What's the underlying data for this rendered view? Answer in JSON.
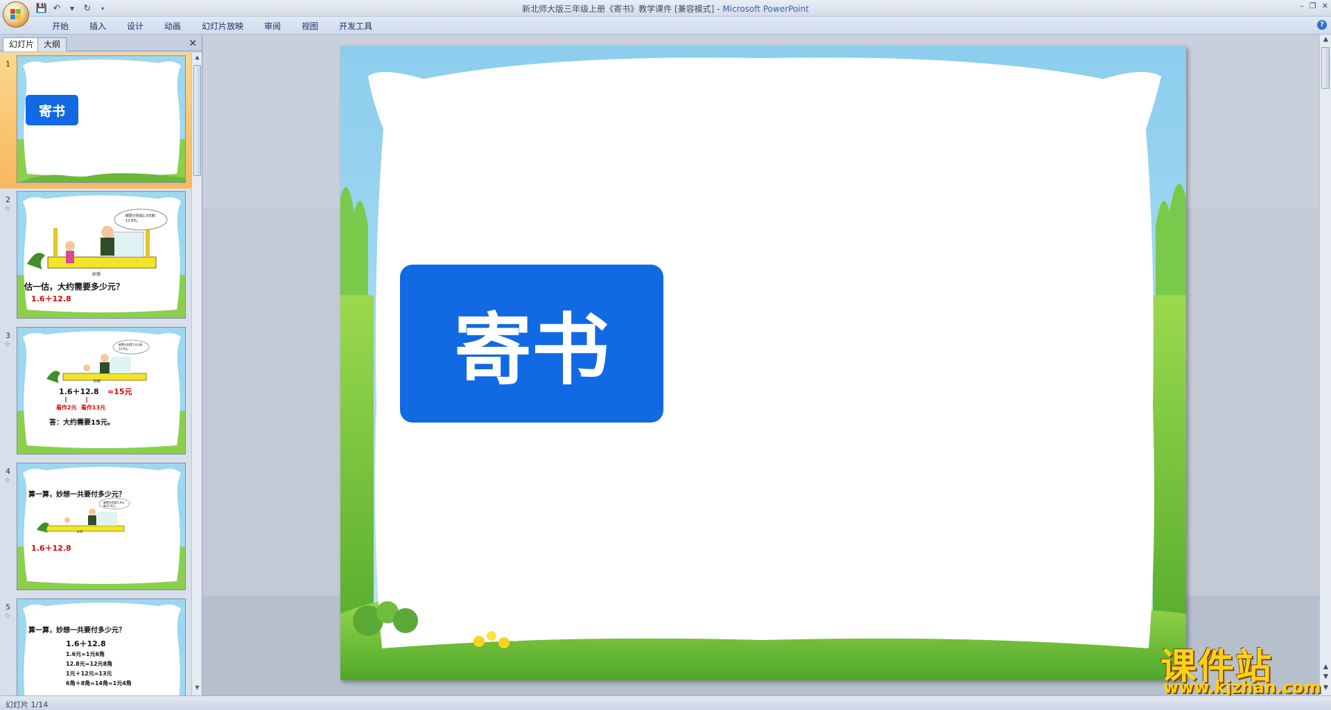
{
  "window": {
    "title": "新北师大版三年级上册《寄书》教学课件 [兼容模式]",
    "app_name": "Microsoft PowerPoint"
  },
  "ribbon": {
    "tabs": [
      {
        "label": "开始"
      },
      {
        "label": "插入"
      },
      {
        "label": "设计"
      },
      {
        "label": "动画"
      },
      {
        "label": "幻灯片放映"
      },
      {
        "label": "审阅"
      },
      {
        "label": "视图"
      },
      {
        "label": "开发工具"
      }
    ]
  },
  "left_pane": {
    "tab_slides": "幻灯片",
    "tab_outline": "大纲"
  },
  "thumbnails": [
    {
      "number": "1",
      "title": "寄书"
    },
    {
      "number": "2",
      "question": "估一估，大约需要多少元？",
      "expr": "1.6＋12.8",
      "bubble": "邮费分别是1.6元和12.8元。",
      "label": "妙想"
    },
    {
      "number": "3",
      "expr": "1.6＋12.8",
      "approx": "≈15元",
      "note_a": "看作2元",
      "note_b": "看作13元",
      "answer": "答：大约需要15元。",
      "bubble": "邮费分别是1.6元和12.8元。",
      "label": "妙想"
    },
    {
      "number": "4",
      "question": "算一算，妙想一共要付多少元？",
      "expr": "1.6＋12.8",
      "bubble": "邮费分别是1.6元和12.8元。",
      "label": "妙想"
    },
    {
      "number": "5",
      "question": "算一算，妙想一共要付多少元？",
      "expr": "1.6＋12.8",
      "lines": [
        "1.6元=1元6角",
        "12.8元=12元8角",
        "1元＋12元=13元",
        "6角＋8角=14角=1元4角"
      ]
    }
  ],
  "main_slide": {
    "title": "寄书"
  },
  "status": {
    "slide_info": "幻灯片 1/14"
  },
  "watermark": {
    "brand": "课件站",
    "url": "www.kjzhan.com"
  },
  "colors": {
    "title_box": "#1169e3",
    "selection": "#f7b85c",
    "sky": "#8fd0ef",
    "grass": "#7cc940"
  }
}
